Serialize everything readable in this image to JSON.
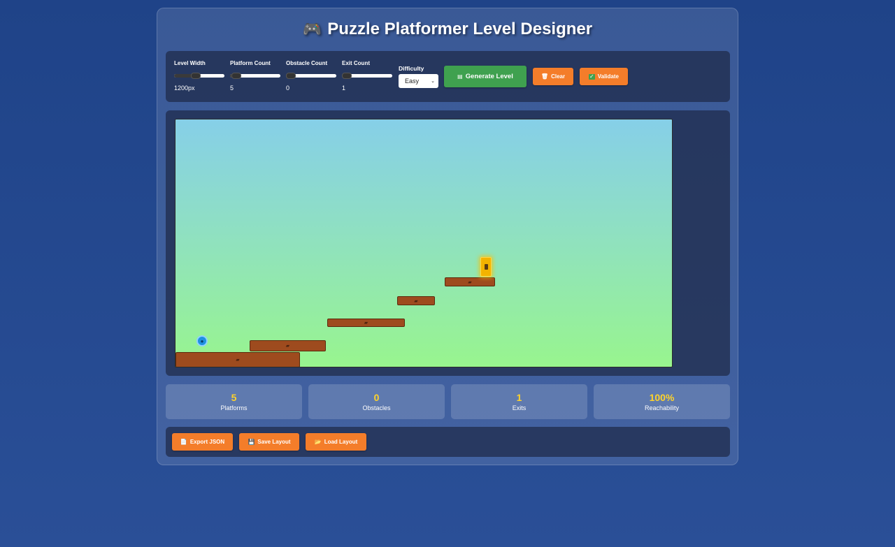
{
  "header": {
    "icon": "game-controller-icon",
    "title": "Puzzle Platformer Level Designer"
  },
  "controls": {
    "level_width": {
      "label": "Level Width",
      "value": "1200px",
      "fraction": 0.42
    },
    "platform_count": {
      "label": "Platform Count",
      "value": "5",
      "fraction": 0.2
    },
    "obstacle_count": {
      "label": "Obstacle Count",
      "value": "0",
      "fraction": 0.0
    },
    "exit_count": {
      "label": "Exit Count",
      "value": "1",
      "fraction": 0.0
    },
    "difficulty": {
      "label": "Difficulty",
      "selected": "Easy"
    },
    "generate_label": "Generate Level",
    "clear_label": "Clear",
    "validate_label": "Validate"
  },
  "stats": [
    {
      "value": "5",
      "label": "Platforms"
    },
    {
      "value": "0",
      "label": "Obstacles"
    },
    {
      "value": "1",
      "label": "Exits"
    },
    {
      "value": "100%",
      "label": "Reachability"
    }
  ],
  "actions": {
    "export_label": "Export JSON",
    "save_label": "Save Layout",
    "load_label": "Load Layout"
  },
  "colors": {
    "background": "#2a4f97",
    "accent_green": "#3fa14f",
    "accent_orange": "#f47d2a",
    "stat_value": "#ffd32a",
    "platform": "#9e4b1e",
    "exit": "#f3b300",
    "player": "#1e90e0"
  }
}
